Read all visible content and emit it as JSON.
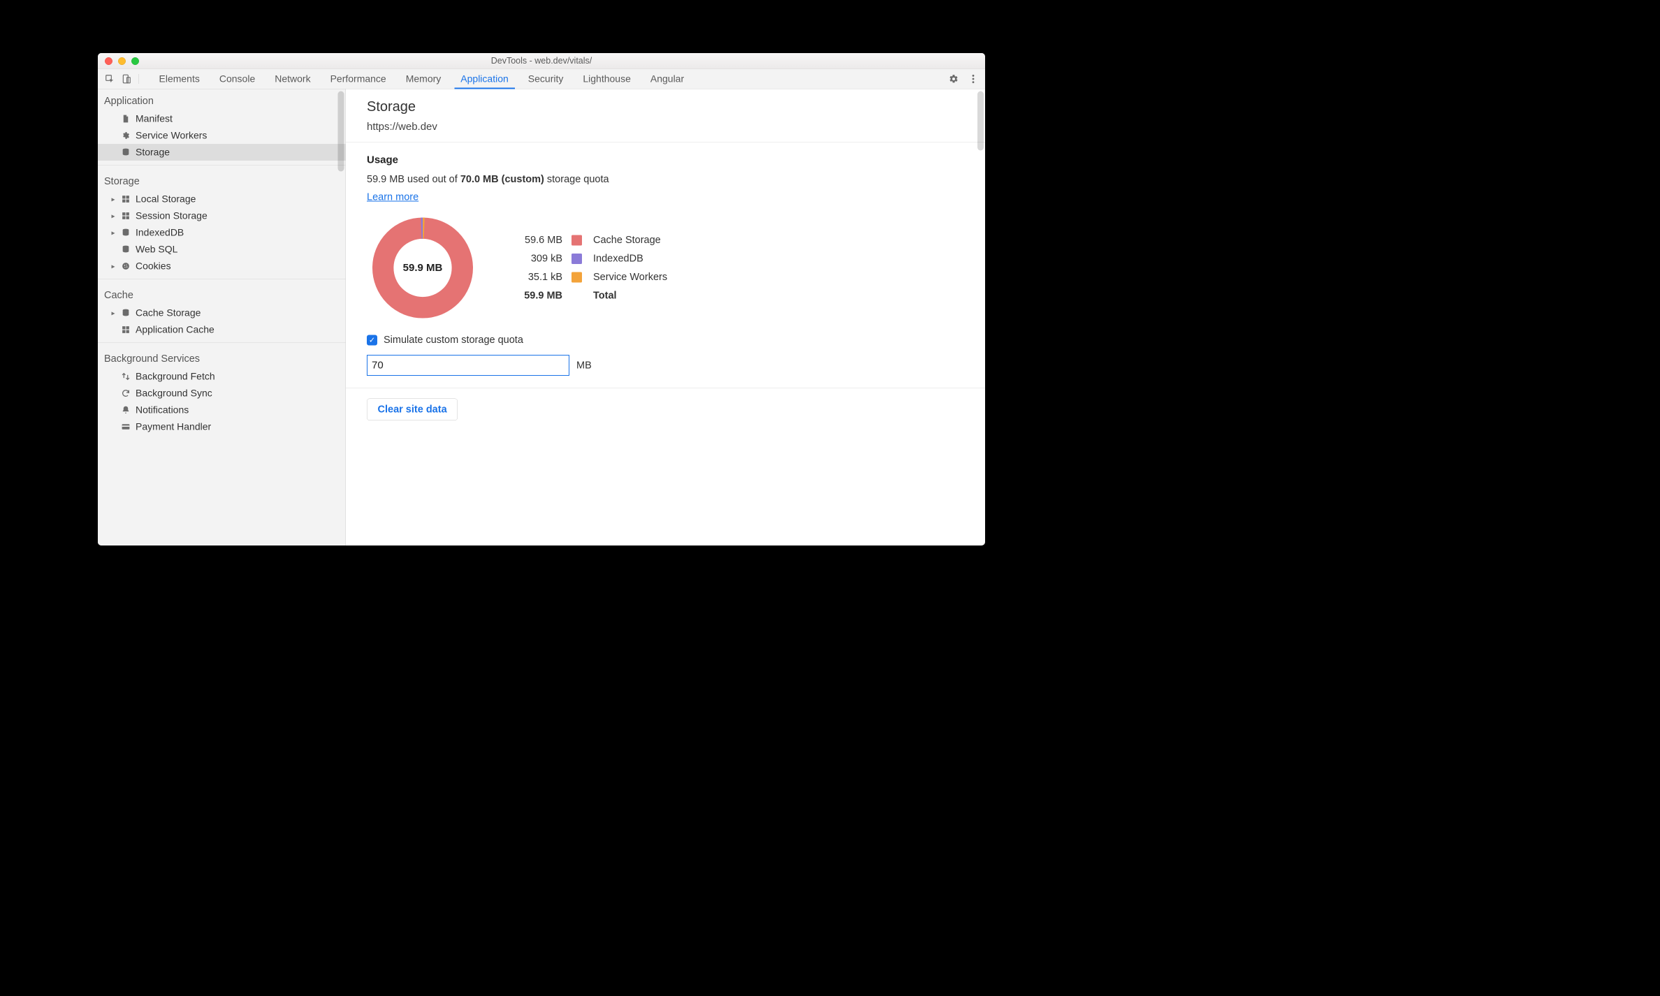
{
  "window_title": "DevTools - web.dev/vitals/",
  "tabs": {
    "items": [
      "Elements",
      "Console",
      "Network",
      "Performance",
      "Memory",
      "Application",
      "Security",
      "Lighthouse",
      "Angular"
    ],
    "active": "Application"
  },
  "sidebar": {
    "sections": [
      {
        "title": "Application",
        "items": [
          {
            "label": "Manifest",
            "icon": "file-icon",
            "expandable": false
          },
          {
            "label": "Service Workers",
            "icon": "gear-icon",
            "expandable": false
          },
          {
            "label": "Storage",
            "icon": "database-icon",
            "expandable": false,
            "selected": true
          }
        ]
      },
      {
        "title": "Storage",
        "items": [
          {
            "label": "Local Storage",
            "icon": "grid-icon",
            "expandable": true
          },
          {
            "label": "Session Storage",
            "icon": "grid-icon",
            "expandable": true
          },
          {
            "label": "IndexedDB",
            "icon": "database-icon",
            "expandable": true
          },
          {
            "label": "Web SQL",
            "icon": "database-icon",
            "expandable": false
          },
          {
            "label": "Cookies",
            "icon": "cookie-icon",
            "expandable": true
          }
        ]
      },
      {
        "title": "Cache",
        "items": [
          {
            "label": "Cache Storage",
            "icon": "database-icon",
            "expandable": true
          },
          {
            "label": "Application Cache",
            "icon": "grid-icon",
            "expandable": false
          }
        ]
      },
      {
        "title": "Background Services",
        "items": [
          {
            "label": "Background Fetch",
            "icon": "swap-icon",
            "expandable": false
          },
          {
            "label": "Background Sync",
            "icon": "sync-icon",
            "expandable": false
          },
          {
            "label": "Notifications",
            "icon": "bell-icon",
            "expandable": false
          },
          {
            "label": "Payment Handler",
            "icon": "card-icon",
            "expandable": false
          }
        ]
      }
    ]
  },
  "main": {
    "title": "Storage",
    "origin": "https://web.dev",
    "usage": {
      "section_title": "Usage",
      "used_prefix": "59.9 MB used out of ",
      "quota_bold": "70.0 MB (custom)",
      "quota_suffix": " storage quota",
      "learn_more": "Learn more",
      "donut_center": "59.9 MB",
      "legend": [
        {
          "value": "59.6 MB",
          "color": "#e57373",
          "label": "Cache Storage"
        },
        {
          "value": "309 kB",
          "color": "#8b7bd8",
          "label": "IndexedDB"
        },
        {
          "value": "35.1 kB",
          "color": "#f3a33a",
          "label": "Service Workers"
        }
      ],
      "total": {
        "value": "59.9 MB",
        "label": "Total"
      },
      "simulate_label": "Simulate custom storage quota",
      "simulate_checked": true,
      "quota_input_value": "70",
      "quota_unit": "MB"
    },
    "clear_button": "Clear site data"
  },
  "chart_data": {
    "type": "pie",
    "title": "Storage usage breakdown",
    "total_label": "59.9 MB",
    "series": [
      {
        "name": "Cache Storage",
        "value": 59.6,
        "unit": "MB",
        "fraction": 0.9943,
        "color": "#e57373"
      },
      {
        "name": "IndexedDB",
        "value": 0.309,
        "unit": "MB",
        "display": "309 kB",
        "fraction": 0.00515,
        "color": "#8b7bd8"
      },
      {
        "name": "Service Workers",
        "value": 0.0351,
        "unit": "MB",
        "display": "35.1 kB",
        "fraction": 0.00059,
        "color": "#f3a33a"
      }
    ]
  }
}
